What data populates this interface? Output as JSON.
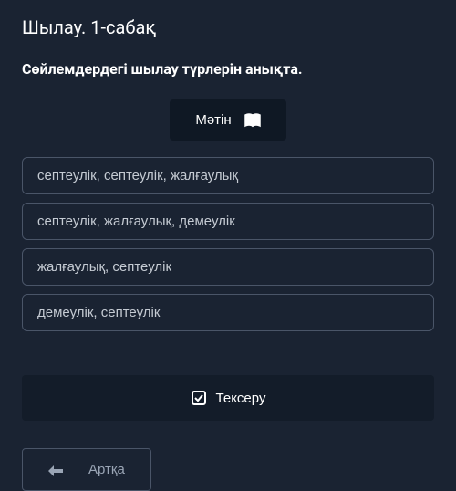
{
  "page_title": "Шылау. 1-сабақ",
  "instruction": "Сөйлемдердегі шылау түрлерін анықта.",
  "text_button_label": "Мәтін",
  "options": [
    "септеулік, септеулік, жалғаулық",
    "септеулік, жалғаулық, демеулік",
    "жалғаулық, септеулік",
    "демеулік, септеулік"
  ],
  "check_button_label": "Тексеру",
  "back_button_label": "Артқа"
}
